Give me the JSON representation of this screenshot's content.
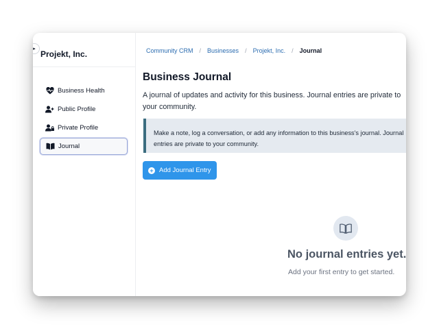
{
  "sidebar": {
    "title": "Projekt, Inc.",
    "items": [
      {
        "label": "Business Health",
        "icon": "heart-pulse-icon",
        "active": false
      },
      {
        "label": "Public Profile",
        "icon": "user-plus-icon",
        "active": false
      },
      {
        "label": "Private Profile",
        "icon": "user-lock-icon",
        "active": false
      },
      {
        "label": "Journal",
        "icon": "book-open-icon",
        "active": true
      }
    ]
  },
  "breadcrumb": {
    "items": [
      "Community CRM",
      "Businesses",
      "Projekt, Inc."
    ],
    "separator": "/",
    "current": "Journal"
  },
  "main": {
    "title": "Business Journal",
    "description": "A journal of updates and activity for this business. Journal entries are private to your community.",
    "callout": "Make a note, log a conversation, or add any information to this business's journal. Journal entries are private to your community.",
    "add_button_label": "Add Journal Entry"
  },
  "empty_state": {
    "icon": "book-open-icon",
    "title": "No journal entries yet.",
    "subtitle": "Add your first entry to get started."
  },
  "colors": {
    "accent": "#2f95ea",
    "link": "#2b6cb0",
    "callout_border": "#3b6d80",
    "callout_bg": "#e5eaf0"
  }
}
